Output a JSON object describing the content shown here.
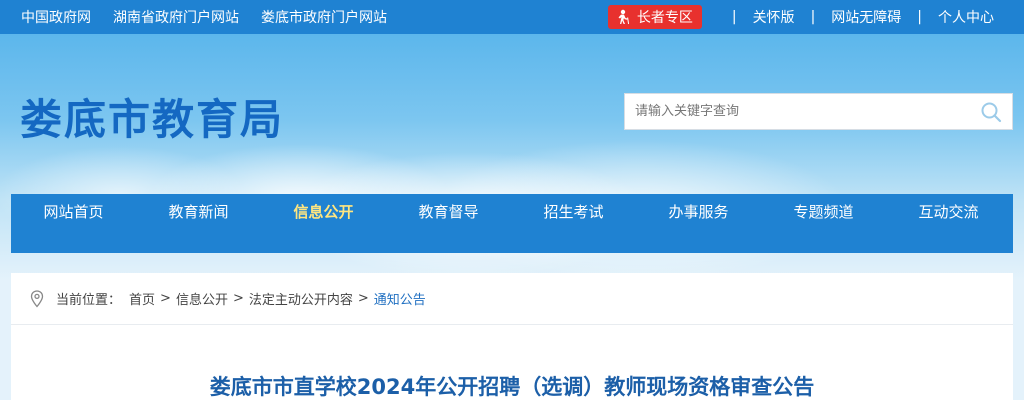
{
  "topbar": {
    "links": [
      "中国政府网",
      "湖南省政府门户网站",
      "娄底市政府门户网站"
    ],
    "elder_label": "长者专区",
    "right_links": [
      "关怀版",
      "网站无障碍",
      "个人中心"
    ],
    "separator": "|"
  },
  "header": {
    "site_title": "娄底市教育局",
    "search_placeholder": "请输入关键字查询"
  },
  "nav": {
    "items": [
      "网站首页",
      "教育新闻",
      "信息公开",
      "教育督导",
      "招生考试",
      "办事服务",
      "专题频道",
      "互动交流"
    ],
    "active": "信息公开"
  },
  "breadcrumb": {
    "label": "当前位置：",
    "items": [
      "首页",
      "信息公开",
      "法定主动公开内容",
      "通知公告"
    ],
    "arrow": ">"
  },
  "article": {
    "title": "娄底市市直学校2024年公开招聘（选调）教师现场资格审查公告"
  },
  "colors": {
    "primary": "#1f82d2",
    "title": "#1468c2",
    "elder": "#e8312e",
    "nav_active": "#ffe680",
    "crumb_current": "#1f6fc1"
  },
  "icons": {
    "elder": "elderly-person-icon",
    "search": "search-icon",
    "location": "location-pin-icon"
  }
}
